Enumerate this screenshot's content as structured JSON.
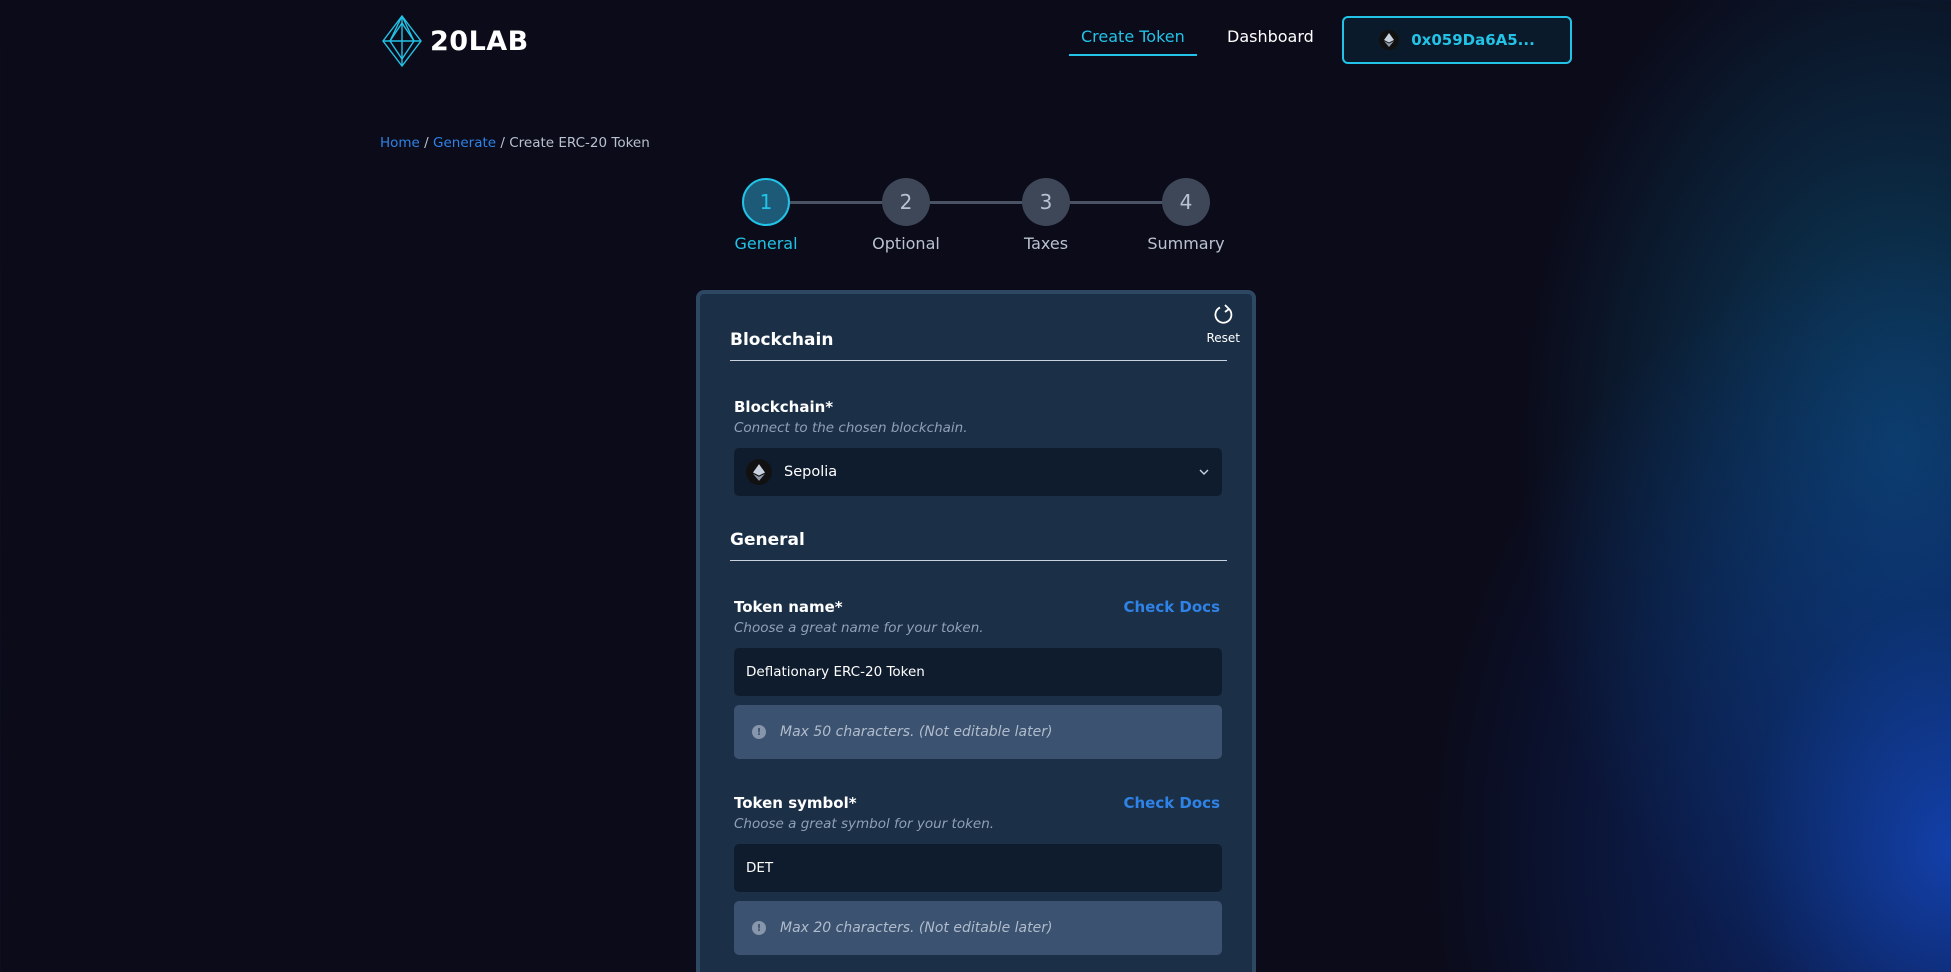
{
  "header": {
    "logo_text": "20LAB",
    "nav": [
      {
        "label": "Create Token",
        "active": true
      },
      {
        "label": "Dashboard",
        "active": false
      }
    ],
    "wallet": {
      "address": "0x059Da6A5...",
      "icon": "ethereum-icon"
    }
  },
  "breadcrumb": {
    "home": "Home",
    "sep1": " / ",
    "generate": "Generate",
    "sep2": " / ",
    "current": "Create ERC-20 Token"
  },
  "stepper": {
    "steps": [
      {
        "number": "1",
        "label": "General",
        "active": true
      },
      {
        "number": "2",
        "label": "Optional",
        "active": false
      },
      {
        "number": "3",
        "label": "Taxes",
        "active": false
      },
      {
        "number": "4",
        "label": "Summary",
        "active": false
      }
    ]
  },
  "card": {
    "reset_label": "Reset",
    "blockchain_section": {
      "title": "Blockchain",
      "label": "Blockchain*",
      "help": "Connect to the chosen blockchain.",
      "selected": "Sepolia"
    },
    "general_section": {
      "title": "General",
      "token_name": {
        "label": "Token name*",
        "docs": "Check Docs",
        "help": "Choose a great name for your token.",
        "value": "Deflationary ERC-20 Token",
        "info": "Max 50 characters. (Not editable later)"
      },
      "token_symbol": {
        "label": "Token symbol*",
        "docs": "Check Docs",
        "help": "Choose a great symbol for your token.",
        "value": "DET",
        "info": "Max 20 characters. (Not editable later)"
      }
    }
  },
  "colors": {
    "accent": "#22c3e6",
    "link": "#2f82e6",
    "background": "#0b0b1a",
    "card": "#1b2f47"
  }
}
